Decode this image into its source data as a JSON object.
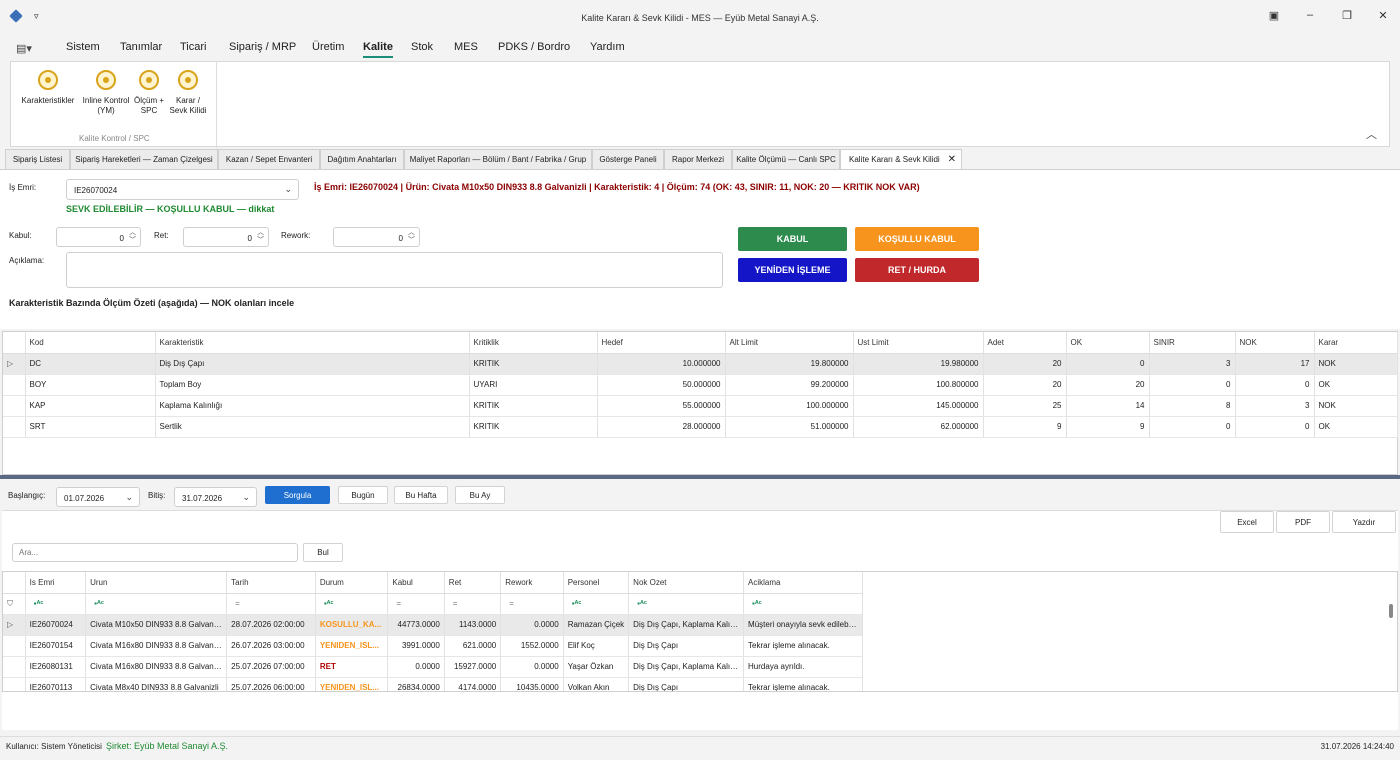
{
  "window": {
    "title": "Kalite Kararı & Sevk Kilidi - MES — Eyüb Metal Sanayi A.Ş."
  },
  "menu": [
    "Sistem",
    "Tanımlar",
    "Ticari",
    "Sipariş / MRP",
    "Üretim",
    "Kalite",
    "Stok",
    "MES",
    "PDKS / Bordro",
    "Yardım"
  ],
  "ribbon": {
    "buttons": [
      "Karakteristikler",
      "Inline Kontrol (YM)",
      "Ölçüm + SPC",
      "Karar / Sevk Kilidi"
    ],
    "group_label": "Kalite Kontrol / SPC"
  },
  "tabs": [
    "Sipariş Listesi",
    "Sipariş Hareketleri — Zaman Çizelgesi",
    "Kazan / Sepet Envanteri",
    "Dağıtım Anahtarları",
    "Maliyet Raporları — Bölüm / Bant / Fabrika / Grup",
    "Gösterge Paneli",
    "Rapor Merkezi",
    "Kalite Ölçümü — Canlı SPC",
    "Kalite Kararı & Sevk Kilidi"
  ],
  "form": {
    "is_emri_label": "İş Emri:",
    "is_emri_value": "IE26070024",
    "summary": "İş Emri: IE26070024  |  Ürün: Civata M10x50 DIN933 8.8 Galvanizli  |  Karakteristik: 4  |  Ölçüm: 74  (OK: 43, SINIR: 11, NOK: 20 — KRITIK NOK VAR)",
    "status": "SEVK EDİLEBİLİR — KOŞULLU KABUL — dikkat",
    "kabul_label": "Kabul:",
    "kabul_value": "0",
    "ret_label": "Ret:",
    "ret_value": "0",
    "rework_label": "Rework:",
    "rework_value": "0",
    "aciklama_label": "Açıklama:",
    "section_title": "Karakteristik Bazında Ölçüm Özeti (aşağıda) — NOK olanları incele"
  },
  "actions": {
    "kabul": "KABUL",
    "kosullu": "KOŞULLU KABUL",
    "yeniden": "YENİDEN İŞLEME",
    "ret": "RET / HURDA",
    "colors": {
      "kabul": "#2e8b4e",
      "kosullu": "#f7941d",
      "yeniden": "#1515c8",
      "ret": "#c0282b"
    }
  },
  "summary_grid": {
    "columns": [
      "Kod",
      "Karakteristik",
      "Kritiklik",
      "Hedef",
      "Alt Limit",
      "Ust Limit",
      "Adet",
      "OK",
      "SINIR",
      "NOK",
      "Karar"
    ],
    "rows": [
      [
        "DC",
        "Diş Dış Çapı",
        "KRITIK",
        "10.000000",
        "19.800000",
        "19.980000",
        "20",
        "0",
        "3",
        "17",
        "NOK"
      ],
      [
        "BOY",
        "Toplam Boy",
        "UYARI",
        "50.000000",
        "99.200000",
        "100.800000",
        "20",
        "20",
        "0",
        "0",
        "OK"
      ],
      [
        "KAP",
        "Kaplama Kalınlığı",
        "KRITIK",
        "55.000000",
        "100.000000",
        "145.000000",
        "25",
        "14",
        "8",
        "3",
        "NOK"
      ],
      [
        "SRT",
        "Sertlik",
        "KRITIK",
        "28.000000",
        "51.000000",
        "62.000000",
        "9",
        "9",
        "0",
        "0",
        "OK"
      ]
    ]
  },
  "filter": {
    "baslangic_label": "Başlangıç:",
    "baslangic": "01.07.2026",
    "bitis_label": "Bitiş:",
    "bitis": "31.07.2026",
    "sorgula": "Sorgula",
    "bugun": "Bugün",
    "bu_hafta": "Bu Hafta",
    "bu_ay": "Bu Ay",
    "excel": "Excel",
    "pdf": "PDF",
    "yazdir": "Yazdır",
    "search_placeholder": "Ara...",
    "bul": "Bul"
  },
  "history_grid": {
    "columns": [
      "Is Emri",
      "Urun",
      "Tarih",
      "Durum",
      "Kabul",
      "Ret",
      "Rework",
      "Personel",
      "Nok Ozet",
      "Aciklama"
    ],
    "rows": [
      [
        "IE26070024",
        "Civata M10x50 DIN933 8.8 Galvanizli",
        "28.07.2026 02:00:00",
        "KOSULLU_KA...",
        "44773.0000",
        "1143.0000",
        "0.0000",
        "Ramazan Çiçek",
        "Diş Dış Çapı, Kaplama Kalınlığı",
        "Müşteri onayıyla sevk edilebilir."
      ],
      [
        "IE26070154",
        "Civata M16x80 DIN933 8.8 Galvanizli",
        "26.07.2026 03:00:00",
        "YENIDEN_ISL...",
        "3991.0000",
        "621.0000",
        "1552.0000",
        "Elif Koç",
        "Diş Dış Çapı",
        "Tekrar işleme alınacak."
      ],
      [
        "IE26080131",
        "Civata M16x80 DIN933 8.8 Galvanizli",
        "25.07.2026 07:00:00",
        "RET",
        "0.0000",
        "15927.0000",
        "0.0000",
        "Yaşar Özkan",
        "Diş Dış Çapı, Kaplama Kalınlığı",
        "Hurdaya ayrıldı."
      ],
      [
        "IE26070113",
        "Civata M8x40 DIN933 8.8 Galvanizli",
        "25.07.2026 06:00:00",
        "YENIDEN_ISL...",
        "26834.0000",
        "4174.0000",
        "10435.0000",
        "Volkan Akın",
        "Diş Dış Çapı",
        "Tekrar işleme alınacak."
      ]
    ]
  },
  "status_colors": {
    "KOSULLU_KA...": "#f7941d",
    "YENIDEN_ISL...": "#f7941d",
    "RET": "#b00000"
  },
  "statusbar": {
    "user": "Kullanıcı: Sistem Yöneticisi",
    "company": "Şirket: Eyüb Metal Sanayi A.Ş.",
    "datetime": "31.07.2026 14:24:40"
  }
}
